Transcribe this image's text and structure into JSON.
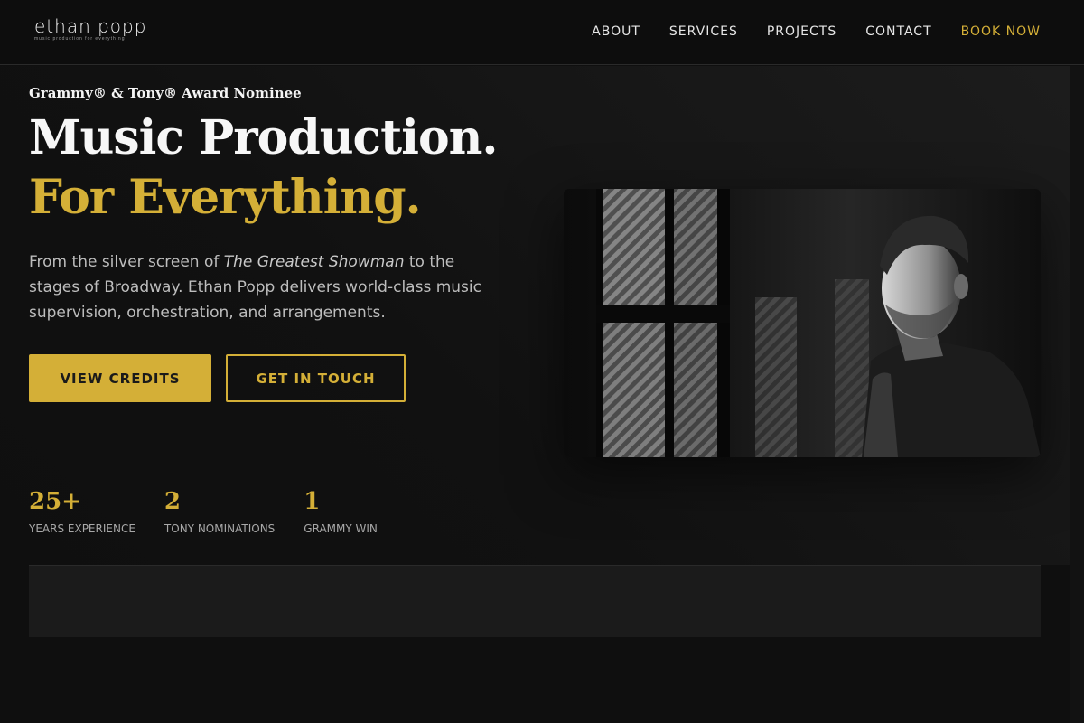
{
  "brand": {
    "name": "ethan popp",
    "tagline": "music production for everything"
  },
  "nav": {
    "items": [
      "ABOUT",
      "SERVICES",
      "PROJECTS",
      "CONTACT"
    ],
    "cta": "BOOK NOW"
  },
  "hero": {
    "award": "Grammy® & Tony® Award Nominee",
    "headline_line1": "Music Production.",
    "headline_line2": "For Everything.",
    "intro_before": "From the silver screen of ",
    "intro_em": "The Greatest Showman",
    "intro_after": " to the stages of Broadway. Ethan Popp delivers world-class music supervision, orchestration, and arrangements.",
    "primary_button": "VIEW CREDITS",
    "secondary_button": "GET IN TOUCH"
  },
  "stats": [
    {
      "value": "25+",
      "label": "YEARS EXPERIENCE"
    },
    {
      "value": "2",
      "label": "TONY NOMINATIONS"
    },
    {
      "value": "1",
      "label": "GRAMMY WIN"
    }
  ],
  "colors": {
    "accent": "#d4af37",
    "background": "#0f0f0f",
    "text": "#f7f7f7"
  }
}
